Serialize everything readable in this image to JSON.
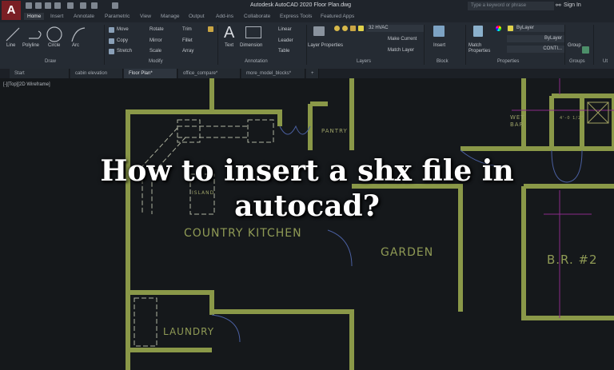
{
  "app": {
    "title": "Autodesk AutoCAD 2020   Floor Plan.dwg",
    "logo": "A",
    "search_placeholder": "Type a keyword or phrase",
    "sign_in": "Sign In"
  },
  "ribbon_tabs": [
    "Home",
    "Insert",
    "Annotate",
    "Parametric",
    "View",
    "Manage",
    "Output",
    "Add-ins",
    "Collaborate",
    "Express Tools",
    "Featured Apps"
  ],
  "ribbon": {
    "draw": {
      "label": "Draw",
      "tools": [
        "Line",
        "Polyline",
        "Circle",
        "Arc"
      ]
    },
    "modify": {
      "label": "Modify",
      "tools": [
        "Move",
        "Copy",
        "Stretch",
        "Rotate",
        "Mirror",
        "Scale",
        "Trim",
        "Fillet",
        "Array"
      ]
    },
    "annotation": {
      "label": "Annotation",
      "tools": [
        "Text",
        "Dimension",
        "Linear",
        "Leader",
        "Table"
      ]
    },
    "layers": {
      "label": "Layers",
      "tools": [
        "Layer Properties",
        "Make Current",
        "Match Layer"
      ],
      "current_layer": "32 HVAC"
    },
    "block": {
      "label": "Block",
      "tools": [
        "Insert"
      ]
    },
    "properties": {
      "label": "Properties",
      "tools": [
        "Match Properties"
      ],
      "color": "ByLayer",
      "lineweight": "ByLayer",
      "linetype": "CONTI..."
    },
    "groups": {
      "label": "Groups",
      "tools": [
        "Group"
      ]
    },
    "utilities": {
      "label": "Ut"
    }
  },
  "file_tabs": [
    {
      "label": "Start"
    },
    {
      "label": "cabin elevation"
    },
    {
      "label": "Floor Plan*"
    },
    {
      "label": "office_compare*"
    },
    {
      "label": "more_model_blocks*"
    }
  ],
  "viewport_label": "[-][Top][2D Wireframe]",
  "rooms": {
    "kitchen": "COUNTRY KITCHEN",
    "garden": "GARDEN",
    "br2": "B.R. #2",
    "laundry": "LAUNDRY",
    "pantry": "PANTRY",
    "island": "ISLAND",
    "wet_bar": "WET BAR",
    "dim": "4'-0 1/2\""
  },
  "headline": {
    "line1": "How to insert a shx file in",
    "line2": "autocad?"
  },
  "colors": {
    "wall": "#8a9848",
    "background": "#15181b",
    "ribbon": "#252b33",
    "accent": "#7a1f24"
  }
}
